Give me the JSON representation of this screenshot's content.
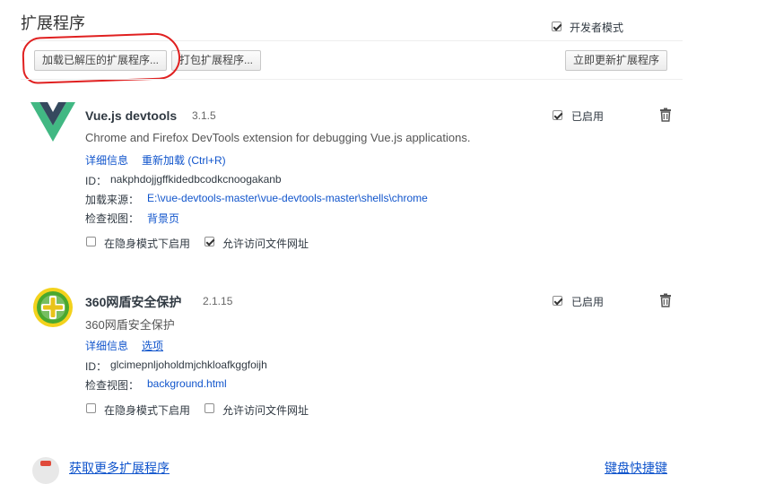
{
  "header": {
    "title": "扩展程序",
    "dev_mode_label": "开发者模式",
    "dev_mode_checked": true
  },
  "toolbar": {
    "load_unpacked_label": "加载已解压的扩展程序...",
    "pack_label": "打包扩展程序...",
    "update_now_label": "立即更新扩展程序"
  },
  "extensions": [
    {
      "name": "Vue.js devtools",
      "version": "3.1.5",
      "description": "Chrome and Firefox DevTools extension for debugging Vue.js applications.",
      "details_link": "详细信息",
      "reload_link": "重新加载 (Ctrl+R)",
      "id_label": "ID：",
      "id_value": "nakphdojjgffkidedbcodkcnoogakanb",
      "load_source_label": "加载来源：",
      "load_source_value": "E:\\vue-devtools-master\\vue-devtools-master\\shells\\chrome",
      "inspect_views_label": "检查视图：",
      "inspect_views_value": "背景页",
      "enabled_label": "已启用",
      "enabled": true,
      "incognito_label": "在隐身模式下启用",
      "incognito": false,
      "file_access_label": "允许访问文件网址",
      "file_access": true
    },
    {
      "name": "360网盾安全保护",
      "version": "2.1.15",
      "description": "360网盾安全保护",
      "details_link": "详细信息",
      "options_link": "选项",
      "id_label": "ID：",
      "id_value": "glcimepnljoholdmjchkloafkggfoijh",
      "inspect_views_label": "检查视图：",
      "inspect_views_value": "background.html",
      "enabled_label": "已启用",
      "enabled": true,
      "incognito_label": "在隐身模式下启用",
      "incognito": false,
      "file_access_label": "允许访问文件网址",
      "file_access": false
    }
  ],
  "footer": {
    "get_more_label": "获取更多扩展程序",
    "shortcuts_label": "键盘快捷键"
  },
  "colors": {
    "link": "#1155cc",
    "annotation": "#e02020",
    "vue_green": "#41b883",
    "vue_dark": "#35495e"
  }
}
